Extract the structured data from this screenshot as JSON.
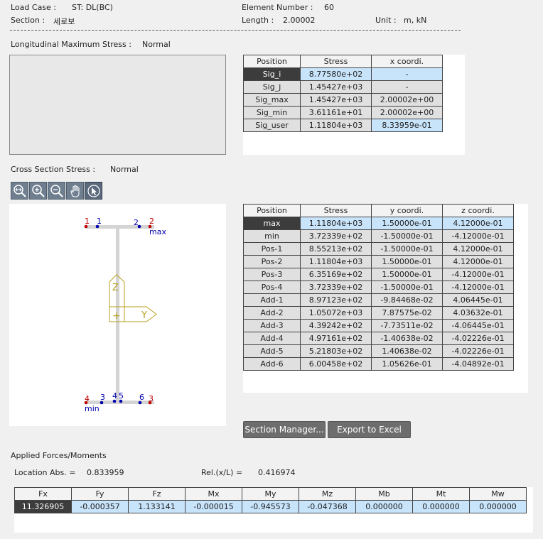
{
  "header": {
    "load_case_label": "Load Case :",
    "load_case_value": "ST: DL(BC)",
    "section_label": "Section :",
    "section_value": "세로보",
    "element_number_label": "Element Number :",
    "element_number_value": "60",
    "length_label": "Length :",
    "length_value": "2.00002",
    "unit_label": "Unit :",
    "unit_value": "m,  kN"
  },
  "longitudinal": {
    "label": "Longitudinal Maximum Stress :",
    "mode": "Normal",
    "columns": [
      "Position",
      "Stress",
      "x coordi."
    ],
    "rows": [
      [
        "Sig_i",
        "8.77580e+02",
        "-"
      ],
      [
        "Sig_j",
        "1.45427e+03",
        "-"
      ],
      [
        "Sig_max",
        "1.45427e+03",
        "2.00002e+00"
      ],
      [
        "Sig_min",
        "3.61161e+01",
        "2.00002e+00"
      ],
      [
        "Sig_user",
        "1.11804e+03",
        "8.33959e-01"
      ]
    ]
  },
  "cross_section": {
    "label": "Cross Section Stress :",
    "mode": "Normal",
    "toolbar": [
      "zoom-fit-icon",
      "zoom-in-icon",
      "zoom-out-icon",
      "pan-hand-icon",
      "select-pointer-icon"
    ],
    "drawing": {
      "top_points": [
        "1",
        "1",
        "2",
        "2"
      ],
      "top_label": "max",
      "bottom_points": [
        "4",
        "3",
        "4",
        "5",
        "6",
        "3"
      ],
      "bottom_label": "min",
      "axis_z": "Z",
      "axis_y": "Y",
      "origin_marker": "+"
    },
    "columns": [
      "Position",
      "Stress",
      "y coordi.",
      "z coordi."
    ],
    "rows": [
      [
        "max",
        "1.11804e+03",
        "1.50000e-01",
        "4.12000e-01"
      ],
      [
        "min",
        "3.72339e+02",
        "-1.50000e-01",
        "-4.12000e-01"
      ],
      [
        "Pos-1",
        "8.55213e+02",
        "-1.50000e-01",
        "4.12000e-01"
      ],
      [
        "Pos-2",
        "1.11804e+03",
        "1.50000e-01",
        "4.12000e-01"
      ],
      [
        "Pos-3",
        "6.35169e+02",
        "1.50000e-01",
        "-4.12000e-01"
      ],
      [
        "Pos-4",
        "3.72339e+02",
        "-1.50000e-01",
        "-4.12000e-01"
      ],
      [
        "Add-1",
        "8.97123e+02",
        "-9.84468e-02",
        "4.06445e-01"
      ],
      [
        "Add-2",
        "1.05072e+03",
        "7.87575e-02",
        "4.03632e-01"
      ],
      [
        "Add-3",
        "4.39242e+02",
        "-7.73511e-02",
        "-4.06445e-01"
      ],
      [
        "Add-4",
        "4.97161e+02",
        "-1.40638e-02",
        "-4.02226e-01"
      ],
      [
        "Add-5",
        "5.21803e+02",
        "1.40638e-02",
        "-4.02226e-01"
      ],
      [
        "Add-6",
        "6.00458e+02",
        "1.05626e-01",
        "-4.04892e-01"
      ]
    ]
  },
  "buttons": {
    "section_manager": "Section Manager...",
    "export_excel": "Export to Excel"
  },
  "forces": {
    "label": "Applied Forces/Moments",
    "location_abs_label": "Location Abs. =",
    "location_abs_value": "0.833959",
    "rel_label": "Rel.(x/L) =",
    "rel_value": "0.416974",
    "columns": [
      "Fx",
      "Fy",
      "Fz",
      "Mx",
      "My",
      "Mz",
      "Mb",
      "Mt",
      "Mw"
    ],
    "values": [
      "11.326905",
      "-0.000357",
      "1.133141",
      "-0.000015",
      "-0.945573",
      "-0.047368",
      "0.000000",
      "0.000000",
      "0.000000"
    ]
  },
  "colors": {
    "selected_cell": "#3c3c3c",
    "highlight_cell": "#c8e4fb",
    "point_red": "#c00000",
    "point_blue": "#0000b0",
    "axis_color": "#b8a020"
  }
}
